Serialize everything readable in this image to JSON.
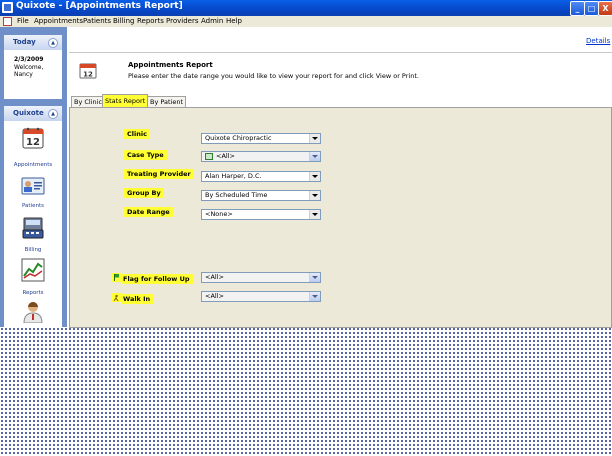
{
  "window": {
    "title": "Quixote - [Appointments Report]",
    "buttons": {
      "minimize": "_",
      "maximize": "□",
      "close": "X"
    }
  },
  "menu": {
    "items": [
      "File",
      "Appointments",
      "Patients",
      "Billing",
      "Reports",
      "Providers",
      "Admin",
      "Help"
    ]
  },
  "sidebar": {
    "today": {
      "title": "Today",
      "date": "2/3/2009",
      "welcome": "Welcome,",
      "user": "Nancy"
    },
    "quixote": {
      "title": "Quixote",
      "items": [
        {
          "label": "Appointments",
          "icon": "calendar-icon"
        },
        {
          "label": "Patients",
          "icon": "patient-card-icon"
        },
        {
          "label": "Billing",
          "icon": "billing-icon"
        },
        {
          "label": "Reports",
          "icon": "chart-icon"
        },
        {
          "label": "",
          "icon": "provider-icon"
        }
      ]
    }
  },
  "header": {
    "details_link": "Details",
    "title": "Appointments Report",
    "description": "Please enter the date range you would like to view your report for and click View or Print."
  },
  "tabs": [
    {
      "label": "By Clinic",
      "active": false
    },
    {
      "label": "Stats Report",
      "active": true
    },
    {
      "label": "By Patient",
      "active": false
    }
  ],
  "form": {
    "clinic": {
      "label": "Clinic",
      "value": "Quixote Chiropractic"
    },
    "case_type": {
      "label": "Case Type",
      "value": "<All>"
    },
    "treating_provider": {
      "label": "Treating Provider",
      "value": "Alan Harper, D.C."
    },
    "group_by": {
      "label": "Group By",
      "value": "By Scheduled Time"
    },
    "date_range": {
      "label": "Date Range",
      "value": "<None>"
    },
    "flag_follow_up": {
      "label": "Flag for Follow Up",
      "value": "<All>"
    },
    "walk_in": {
      "label": "Walk In",
      "value": "<All>"
    }
  },
  "colors": {
    "highlight": "#ffff33",
    "sidebar": "#6f8fc9",
    "titlebar": "#0647c8"
  }
}
